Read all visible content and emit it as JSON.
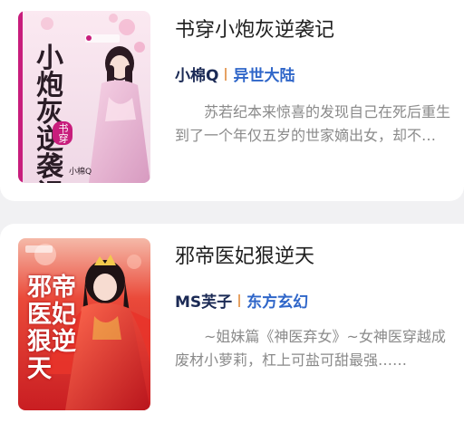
{
  "books": [
    {
      "title": "书穿小炮灰逆袭记",
      "author": "小棉Q",
      "genre": "异世大陆",
      "description": "苏若纪本来惊喜的发现自己在死后重生到了一个年仅五岁的世家嫡出女，却不料……",
      "cover": {
        "title_chars": "小炮灰逆袭记",
        "tag": "书穿",
        "author_mark": "小棉Q",
        "colors": {
          "bg": "#f5e6ef",
          "accent": "#c81d7c",
          "ink": "#2a1c26"
        }
      }
    },
    {
      "title": "邪帝医妃狠逆天",
      "author": "MS芙子",
      "genre": "东方玄幻",
      "description": "~姐妹篇《神医弃女》~女神医穿越成废材小萝莉，杠上可盐可甜最强……",
      "cover": {
        "title_chars": "邪帝医妃狠逆天",
        "colors": {
          "bg": "#e8372e",
          "accent": "#ffffff",
          "ink": "#f7f0e0"
        }
      }
    }
  ],
  "colors": {
    "author": "#1b2a55",
    "genre": "#2f66c9",
    "separator": "#e6a264",
    "description": "#8a8a8a"
  }
}
